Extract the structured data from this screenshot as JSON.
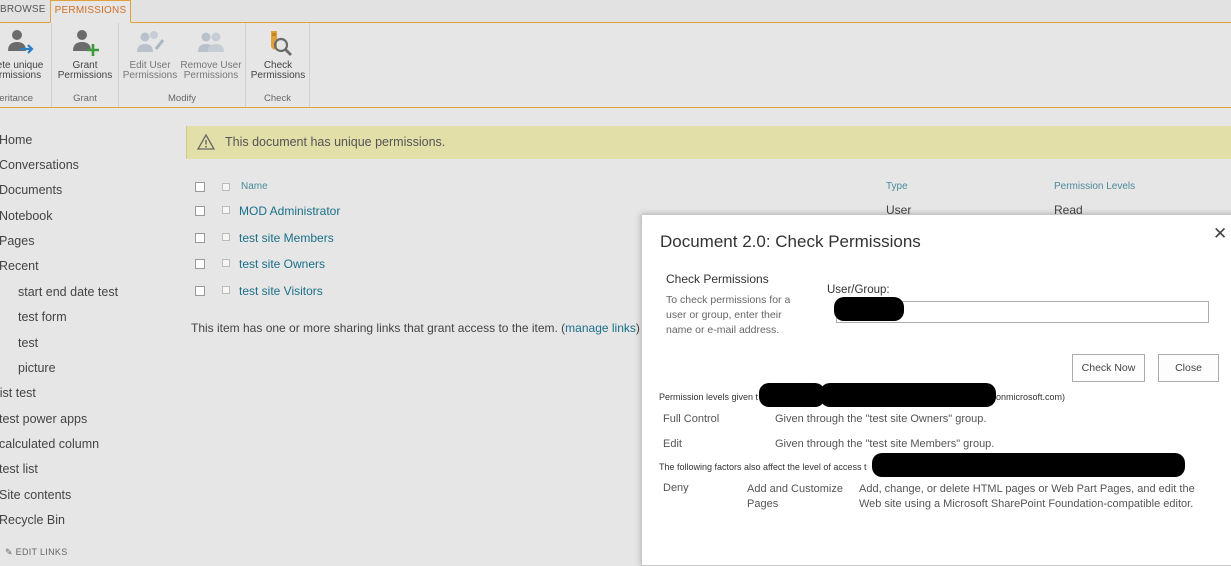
{
  "ribbon": {
    "tabs": [
      {
        "label": "BROWSE"
      },
      {
        "label": "PERMISSIONS",
        "active": true
      }
    ],
    "groups": [
      {
        "label": "heritance",
        "buttons": [
          {
            "label_line1": "ete unique",
            "label_line2": "rmissions"
          }
        ]
      },
      {
        "label": "Grant",
        "buttons": [
          {
            "label_line1": "Grant",
            "label_line2": "Permissions"
          }
        ]
      },
      {
        "label": "Modify",
        "buttons": [
          {
            "label_line1": "Edit User",
            "label_line2": "Permissions"
          },
          {
            "label_line1": "Remove User",
            "label_line2": "Permissions"
          }
        ]
      },
      {
        "label": "Check",
        "buttons": [
          {
            "label_line1": "Check",
            "label_line2": "Permissions"
          }
        ]
      }
    ]
  },
  "nav": {
    "items": [
      {
        "label": "Home"
      },
      {
        "label": "Conversations"
      },
      {
        "label": "Documents"
      },
      {
        "label": "Notebook"
      },
      {
        "label": "Pages"
      },
      {
        "label": "Recent"
      },
      {
        "label": "start end date test"
      },
      {
        "label": "test form"
      },
      {
        "label": "test"
      },
      {
        "label": "picture"
      },
      {
        "label": "list test"
      },
      {
        "label": "test power apps"
      },
      {
        "label": "calculated column"
      },
      {
        "label": "test list"
      },
      {
        "label": "Site contents"
      },
      {
        "label": "Recycle Bin"
      }
    ],
    "edit_links": "EDIT LINKS"
  },
  "main": {
    "warning": "This document has unique permissions.",
    "columns": {
      "name": "Name",
      "type": "Type",
      "levels": "Permission Levels"
    },
    "rows": [
      {
        "name": "MOD Administrator",
        "type": "User",
        "level": "Read"
      },
      {
        "name": "test site Members",
        "type": "",
        "level": ""
      },
      {
        "name": "test site Owners",
        "type": "",
        "level": ""
      },
      {
        "name": "test site Visitors",
        "type": "",
        "level": ""
      }
    ],
    "sharing_text": "This item has one or more sharing links that grant access to the item. (",
    "manage_links": "manage links",
    "sharing_close": ")"
  },
  "dialog": {
    "title": "Document 2.0: Check Permissions",
    "close_icon": "close-icon",
    "section_title": "Check Permissions",
    "section_desc": "To check permissions for a user or group, enter their name or e-mail address.",
    "user_group_label": "User/Group:",
    "check_now": "Check Now",
    "close": "Close",
    "levels_heading": "Permission levels given t",
    "levels_heading_tail": "onmicrosoft.com)",
    "permission_levels": [
      {
        "name": "Full Control",
        "desc": "Given through the \"test site Owners\" group."
      },
      {
        "name": "Edit",
        "desc": "Given through the \"test site Members\" group."
      }
    ],
    "factors_heading": "The following factors also affect the level of access t",
    "deny": {
      "type": "Deny",
      "permission": "Add and Customize Pages",
      "desc": "Add, change, or delete HTML pages or Web Part Pages, and edit the Web site using a Microsoft SharePoint Foundation-compatible editor."
    }
  }
}
